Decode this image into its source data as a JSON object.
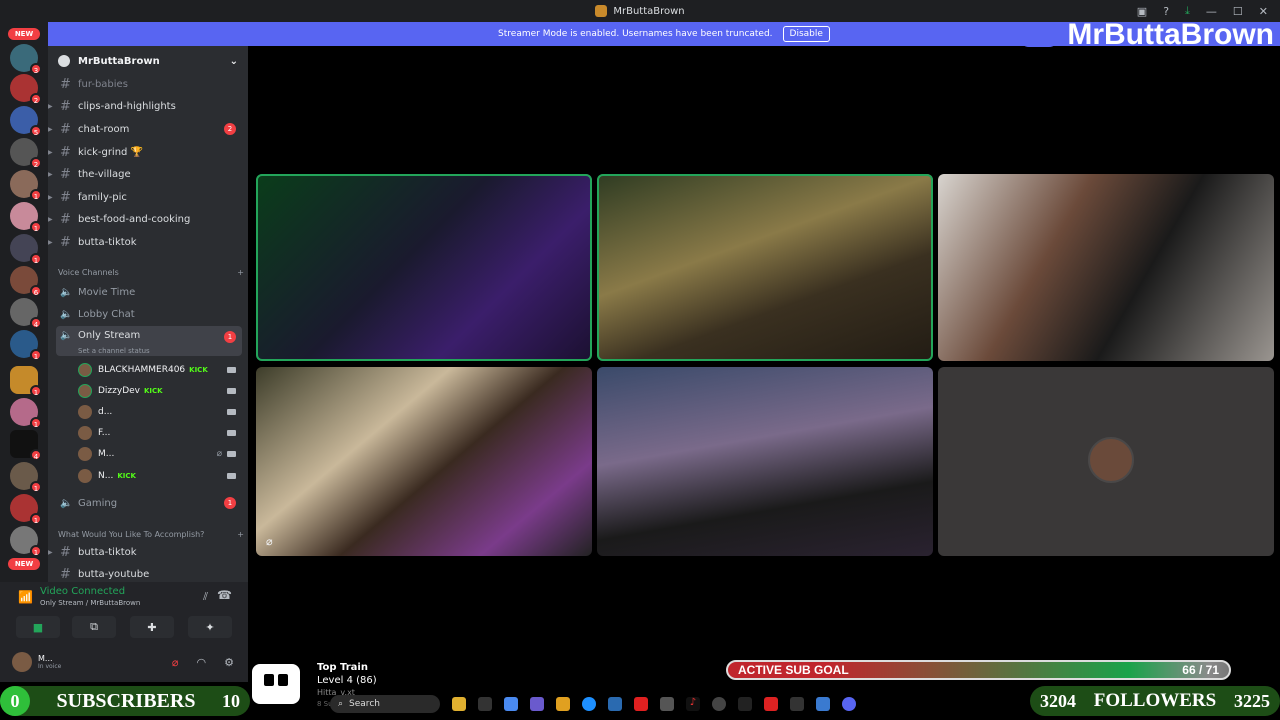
{
  "window": {
    "title": "MrButtaBrown"
  },
  "streamer_bar": {
    "text": "Streamer Mode is enabled. Usernames have been truncated.",
    "button": "Disable"
  },
  "brand": {
    "name": "MrButtaBrown"
  },
  "servers": {
    "new_top": "NEW",
    "new_bottom": "NEW",
    "badges": [
      "3",
      "2",
      "5",
      "2",
      "1",
      "1",
      "1",
      "6",
      "4",
      "1",
      "1",
      "1",
      "4",
      "1",
      "1",
      "1",
      "1",
      "1"
    ]
  },
  "guild": {
    "name": "MrButtaBrown"
  },
  "text_channels": [
    {
      "name": "fur-babies",
      "muted": true,
      "badge": ""
    },
    {
      "name": "clips-and-highlights",
      "muted": false,
      "badge": ""
    },
    {
      "name": "chat-room",
      "muted": false,
      "badge": "2"
    },
    {
      "name": "kick-grind 🏆",
      "muted": false,
      "badge": ""
    },
    {
      "name": "the-village",
      "muted": false,
      "badge": ""
    },
    {
      "name": "family-pic",
      "muted": false,
      "badge": ""
    },
    {
      "name": "best-food-and-cooking",
      "muted": false,
      "badge": ""
    },
    {
      "name": "butta-tiktok",
      "muted": false,
      "badge": ""
    }
  ],
  "voice_category": {
    "label": "Voice Channels"
  },
  "voice_channels": [
    {
      "name": "Movie Time"
    },
    {
      "name": "Lobby Chat"
    },
    {
      "name": "Only Stream",
      "status": "Set a channel status",
      "badge": "1"
    },
    {
      "name": "Gaming",
      "badge": "1"
    }
  ],
  "voice_users": [
    {
      "name": "BLACKHAMMER406",
      "kick": "KICK"
    },
    {
      "name": "DizzyDev",
      "kick": "KICK"
    },
    {
      "name": "d...",
      "kick": ""
    },
    {
      "name": "F...",
      "kick": ""
    },
    {
      "name": "M...",
      "kick": ""
    },
    {
      "name": "N...",
      "kick": "KICK"
    }
  ],
  "category2": {
    "label": "What Would You Like To Accomplish?"
  },
  "more_channels": [
    {
      "name": "butta-tiktok"
    },
    {
      "name": "butta-youtube"
    }
  ],
  "voice_status": {
    "title": "Video Connected",
    "location": "Only Stream / MrButtaBrown"
  },
  "me": {
    "name": "M...",
    "status": "In voice"
  },
  "overlay": {
    "subs_left": "0",
    "subs_label": "SUBSCRIBERS",
    "subs_right": "10",
    "followers_left": "3204",
    "followers_label": "FOLLOWERS",
    "followers_right": "3225",
    "sub_goal_label": "ACTIVE SUB GOAL",
    "sub_goal_value": "66 / 71",
    "sub_goal_fraction": 0.93,
    "train_title": "Top Train",
    "train_level": "Level 4 (86)",
    "train_user": "Hitta_v.xt",
    "train_subs": "8 Subs"
  },
  "taskbar": {
    "search": "Search"
  },
  "colors": {
    "accent": "#5865f2",
    "speaking": "#23a55a",
    "badge": "#f23f43",
    "kick": "#53fc18"
  }
}
